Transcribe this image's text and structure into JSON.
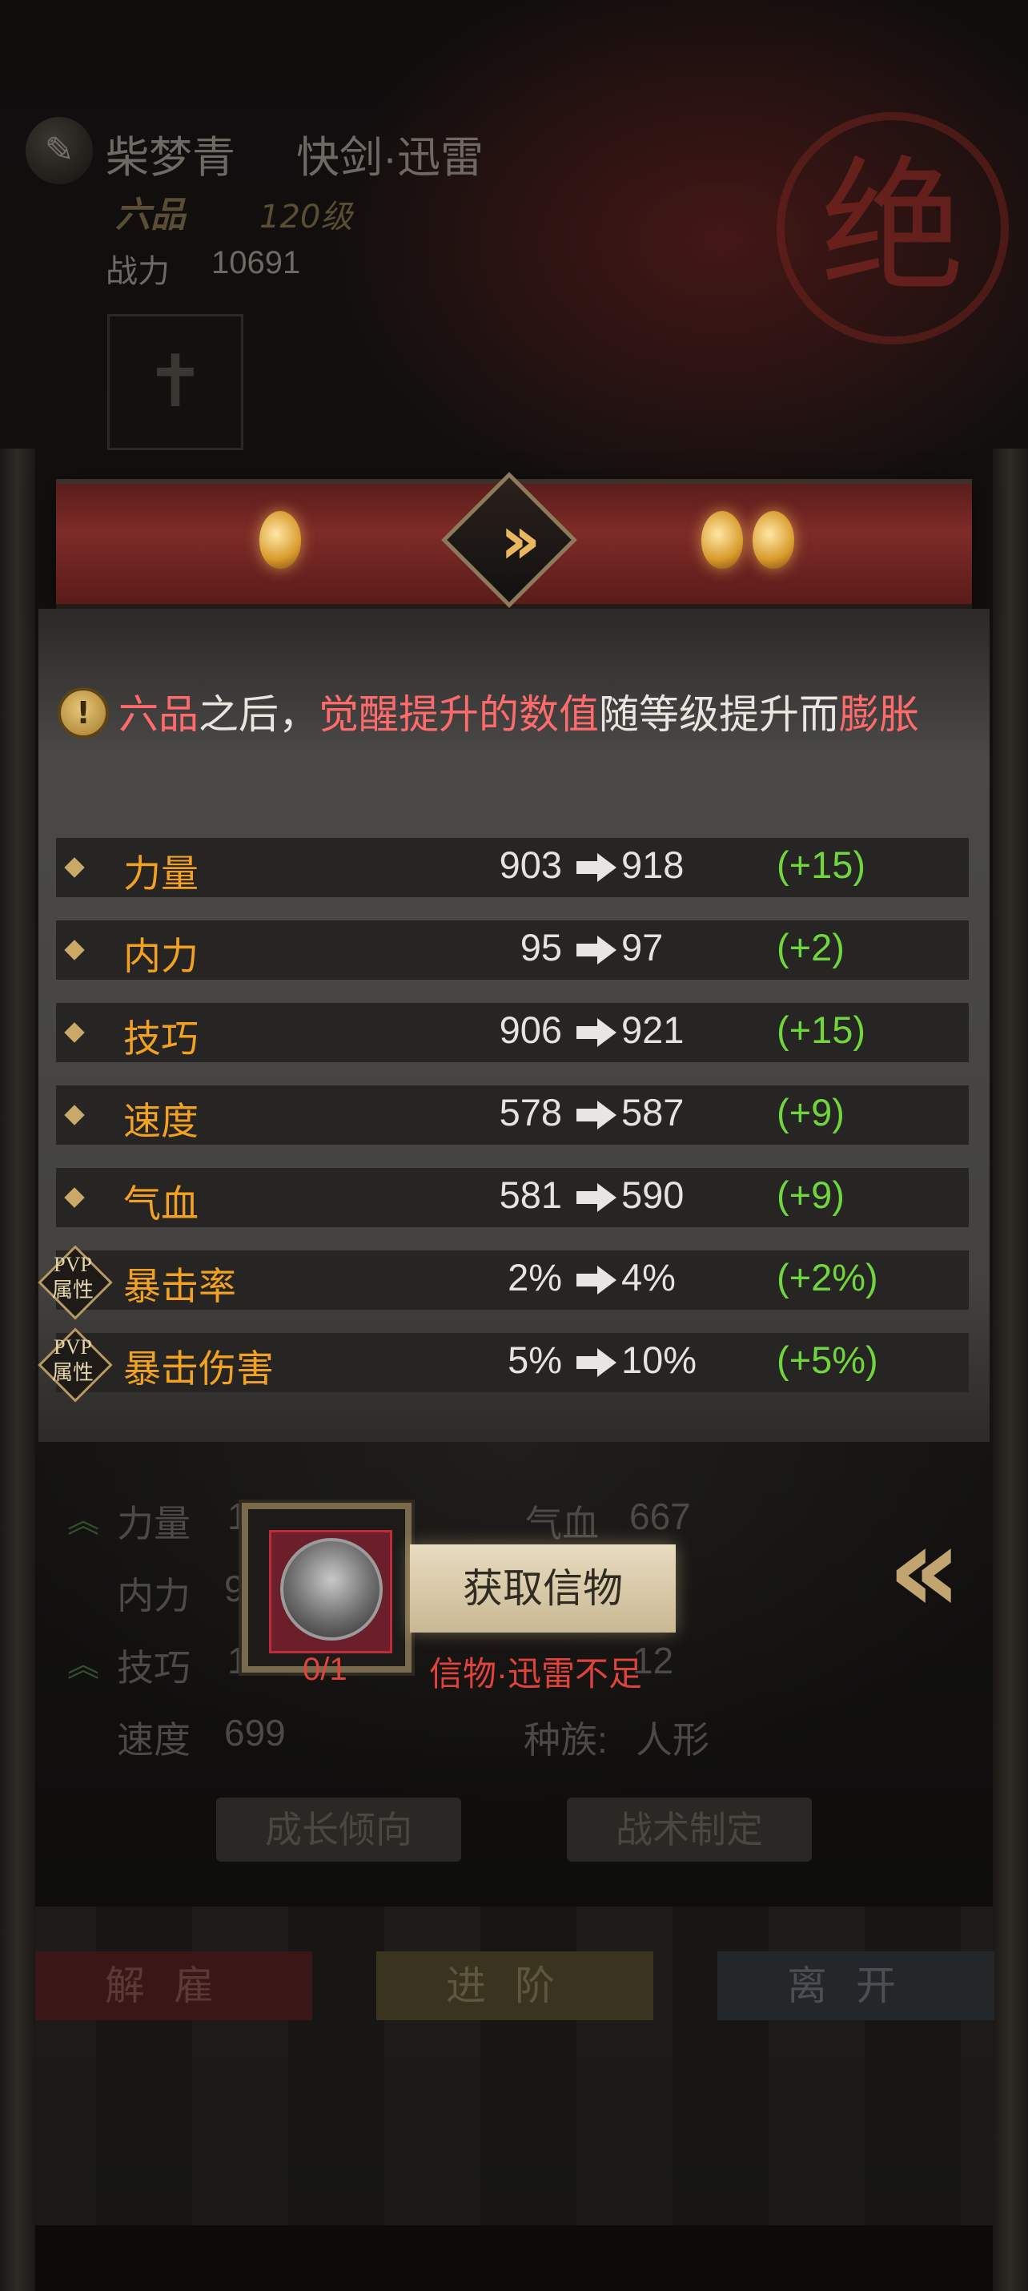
{
  "header": {
    "hero_name": "柴梦青",
    "hero_skill": "快剑·迅雷",
    "rank": "六品",
    "level": "120级",
    "power_label": "战力",
    "power_value": "10691",
    "seal_char": "绝"
  },
  "notice": {
    "p1": "六品",
    "p2": "之后，",
    "p3": "觉醒提升的数值",
    "p4": "随等级提升而",
    "p5": "膨胀"
  },
  "stats": [
    {
      "name": "力量",
      "old": "903",
      "new": "918",
      "delta": "(+15)",
      "pvp": false
    },
    {
      "name": "内力",
      "old": "95",
      "new": "97",
      "delta": "(+2)",
      "pvp": false
    },
    {
      "name": "技巧",
      "old": "906",
      "new": "921",
      "delta": "(+15)",
      "pvp": false
    },
    {
      "name": "速度",
      "old": "578",
      "new": "587",
      "delta": "(+9)",
      "pvp": false
    },
    {
      "name": "气血",
      "old": "581",
      "new": "590",
      "delta": "(+9)",
      "pvp": false
    },
    {
      "name": "暴击率",
      "old": "2%",
      "new": "4%",
      "delta": "(+2%)",
      "pvp": true
    },
    {
      "name": "暴击伤害",
      "old": "5%",
      "new": "10%",
      "delta": "(+5%)",
      "pvp": true
    }
  ],
  "pvp_badge": {
    "line1": "PVP",
    "line2": "属性"
  },
  "background_info": {
    "strength_label": "力量",
    "strength_value": "1",
    "qixue_label": "气血",
    "qixue_value": "667",
    "neili_label": "内力",
    "neili_value": "9",
    "skill_label": "技巧",
    "skill_value": "1",
    "right3_value": "12",
    "speed_label": "速度",
    "speed_value": "699",
    "race_label": "种族:",
    "race_value": "人形",
    "growth_button": "成长倾向",
    "tactics_button": "战术制定"
  },
  "item_popup": {
    "count": "0/1",
    "get_button": "获取信物",
    "insufficient": "信物·迅雷不足"
  },
  "bottom_buttons": {
    "dismiss": "解雇",
    "advance": "进阶",
    "leave": "离开"
  },
  "colors": {
    "highlight_red": "#ff6b6b",
    "stat_name_orange": "#f2a122",
    "delta_green": "#6fd63c",
    "error_red": "#e0433a",
    "ribbon_red": "#7e2b28"
  }
}
